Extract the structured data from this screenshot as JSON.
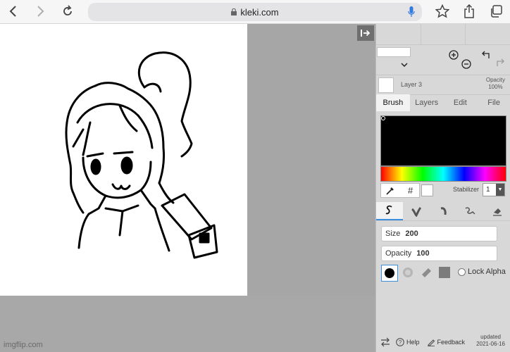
{
  "browser": {
    "url": "kleki.com"
  },
  "watermark": "imgflip.com",
  "panel": {
    "layer_name": "Layer 3",
    "opacity_label": "Opacity",
    "opacity_value": "100%",
    "tabs": [
      "Brush",
      "Layers",
      "Edit",
      "File"
    ],
    "active_tab": "Brush",
    "hex_symbol": "#",
    "stabilizer_label": "Stabilizer",
    "stabilizer_value": "1",
    "size_label": "Size",
    "size_value": "200",
    "opacity_slider_label": "Opacity",
    "opacity_slider_value": "100",
    "lock_alpha": "Lock Alpha",
    "help": "Help",
    "feedback": "Feedback",
    "updated_label": "updated",
    "updated_date": "2021-06-16"
  },
  "colors": {
    "primary": "#000000",
    "accent": "#3a8fdc"
  },
  "icons": [
    "back-icon",
    "forward-icon",
    "reload-icon",
    "lock-icon",
    "mic-icon",
    "star-icon",
    "share-icon",
    "collapse-icon",
    "zoom-in-icon",
    "zoom-out-icon",
    "undo-icon",
    "redo-icon",
    "eyedropper-icon",
    "pen-brush-icon",
    "blend-brush-icon",
    "sketchy-brush-icon",
    "smudge-brush-icon",
    "eraser-icon",
    "swap-icon",
    "help-icon",
    "feedback-icon"
  ]
}
